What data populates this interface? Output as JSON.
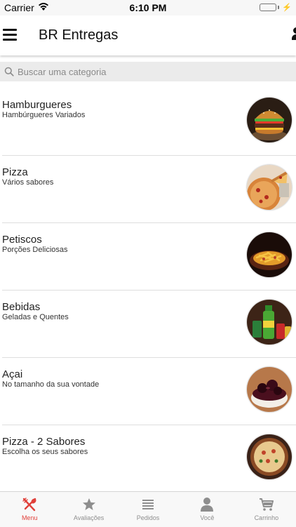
{
  "status_bar": {
    "carrier": "Carrier",
    "time": "6:10 PM"
  },
  "header": {
    "title": "BR Entregas"
  },
  "search": {
    "placeholder": "Buscar uma categoria"
  },
  "categories": [
    {
      "name": "Hamburgueres",
      "description": "Hambúrgueres Variados",
      "image": "burger-image"
    },
    {
      "name": "Pizza",
      "description": "Vários sabores",
      "image": "pizza-slice-image"
    },
    {
      "name": "Petiscos",
      "description": "Porções Deliciosas",
      "image": "fries-plate-image"
    },
    {
      "name": "Bebidas",
      "description": "Geladas e Quentes",
      "image": "drinks-image"
    },
    {
      "name": "Açai",
      "description": "No tamanho da sua vontade",
      "image": "acai-bowl-image"
    },
    {
      "name": "Pizza - 2 Sabores",
      "description": "Escolha os seus sabores",
      "image": "pizza-image"
    }
  ],
  "tabs": [
    {
      "label": "Menu",
      "icon": "cutlery-icon",
      "active": true
    },
    {
      "label": "Avaliações",
      "icon": "star-icon",
      "active": false
    },
    {
      "label": "Pedidos",
      "icon": "list-icon",
      "active": false
    },
    {
      "label": "Você",
      "icon": "person-icon",
      "active": false
    },
    {
      "label": "Carrinho",
      "icon": "cart-icon",
      "active": false
    }
  ],
  "colors": {
    "active_tab": "#e0403a",
    "inactive_tab": "#8e8e8e",
    "battery": "#4cd964"
  }
}
